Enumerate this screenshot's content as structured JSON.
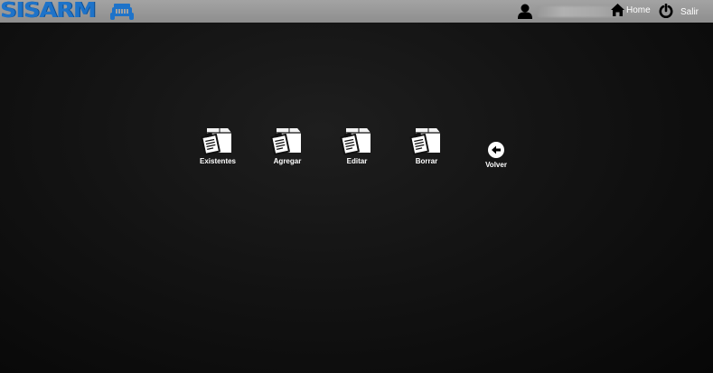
{
  "header": {
    "logo_text": "SISARM",
    "home_label": "Home",
    "exit_label": "Salir",
    "icons": [
      "jeep-icon",
      "user-icon",
      "home-icon",
      "power-icon"
    ]
  },
  "toolbar": {
    "items": [
      {
        "label": "Existentes",
        "icon": "box-clipboard-icon"
      },
      {
        "label": "Agregar",
        "icon": "box-clipboard-icon"
      },
      {
        "label": "Editar",
        "icon": "box-clipboard-icon"
      },
      {
        "label": "Borrar",
        "icon": "box-clipboard-icon"
      }
    ],
    "back_label": "Volver",
    "back_icon": "arrow-left-circle-icon"
  },
  "colors": {
    "topbar": "#999999",
    "logo": "#1e73c9",
    "background": "#111111",
    "text": "#ffffff"
  }
}
